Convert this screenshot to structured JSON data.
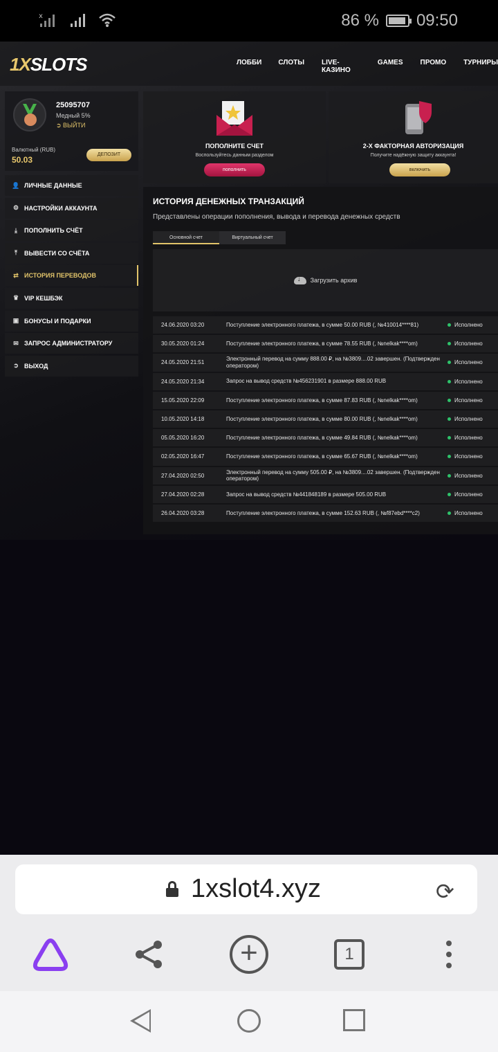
{
  "status_bar": {
    "battery": "86 %",
    "time": "09:50"
  },
  "site": {
    "logo_one": "1X",
    "logo_rest": "SLOTS",
    "nav": [
      "ЛОББИ",
      "СЛОТЫ",
      "LIVE-КАЗИНО",
      "GAMES",
      "ПРОМО",
      "ТУРНИРЫ"
    ],
    "profile": {
      "id": "25095707",
      "level": "Медный 5%",
      "logout": "ВЫЙТИ",
      "currency_label": "Валютный (RUB)",
      "balance": "50.03",
      "deposit_button": "ДЕПОЗИТ"
    },
    "menu": [
      {
        "label": "ЛИЧНЫЕ ДАННЫЕ",
        "icon": "user-plus-icon"
      },
      {
        "label": "НАСТРОЙКИ АККАУНТА",
        "icon": "gears-icon"
      },
      {
        "label": "ПОПОЛНИТЬ СЧЁТ",
        "icon": "download-icon"
      },
      {
        "label": "ВЫВЕСТИ СО СЧЁТА",
        "icon": "upload-icon"
      },
      {
        "label": "ИСТОРИЯ ПЕРЕВОДОВ",
        "icon": "transfer-arrows-icon"
      },
      {
        "label": "VIP КЕШБЭК",
        "icon": "crown-icon"
      },
      {
        "label": "БОНУСЫ И ПОДАРКИ",
        "icon": "gift-icon"
      },
      {
        "label": "ЗАПРОС АДМИНИСТРАТОРУ",
        "icon": "envelope-icon"
      },
      {
        "label": "ВЫХОД",
        "icon": "logout-icon"
      }
    ],
    "cards": {
      "deposit": {
        "title": "ПОПОЛНИТЕ СЧЕТ",
        "text": "Воспользуйтесь данным разделом",
        "button": "пополнить"
      },
      "twofa": {
        "title": "2-Х ФАКТОРНАЯ АВТОРИЗАЦИЯ",
        "text": "Получите надёжную защиту аккаунта!",
        "button": "включить"
      }
    },
    "history": {
      "title": "ИСТОРИЯ ДЕНЕЖНЫХ ТРАНЗАКЦИЙ",
      "subtitle": "Представлены операции пополнения, вывода и перевода денежных средств",
      "tab_main": "Основной счет",
      "tab_virtual": "Виртуальный счет",
      "archive": "Загрузить архив",
      "rows": [
        {
          "date": "24.06.2020 03:20",
          "text": "Поступление электронного платежа, в сумме 50.00 RUB (, №410014****81)",
          "status": "Исполнено"
        },
        {
          "date": "30.05.2020 01:24",
          "text": "Поступление электронного платежа, в сумме 78.55 RUB (, №nelkak****om)",
          "status": "Исполнено"
        },
        {
          "date": "24.05.2020 21:51",
          "text": "Электронный перевод на сумму 888.00 ₽, на №3809....02 завершен. (Подтвержден оператором)",
          "status": "Исполнено"
        },
        {
          "date": "24.05.2020 21:34",
          "text": "Запрос на вывод средств №456231901 в размере 888.00 RUB",
          "status": "Исполнено"
        },
        {
          "date": "15.05.2020 22:09",
          "text": "Поступление электронного платежа, в сумме 87.83 RUB (, №nelkak****om)",
          "status": "Исполнено"
        },
        {
          "date": "10.05.2020 14:18",
          "text": "Поступление электронного платежа, в сумме 80.00 RUB (, №nelkak****om)",
          "status": "Исполнено"
        },
        {
          "date": "05.05.2020 16:20",
          "text": "Поступление электронного платежа, в сумме 49.84 RUB (, №nelkak****om)",
          "status": "Исполнено"
        },
        {
          "date": "02.05.2020 16:47",
          "text": "Поступление электронного платежа, в сумме 65.67 RUB (, №nelkak****om)",
          "status": "Исполнено"
        },
        {
          "date": "27.04.2020 02:50",
          "text": "Электронный перевод на сумму 505.00 ₽, на №3809....02 завершен. (Подтвержден оператором)",
          "status": "Исполнено"
        },
        {
          "date": "27.04.2020 02:28",
          "text": "Запрос на вывод средств №441848189 в размере 505.00 RUB",
          "status": "Исполнено"
        },
        {
          "date": "26.04.2020 03:28",
          "text": "Поступление электронного платежа, в сумме 152.63 RUB (, №f87ebd****c2)",
          "status": "Исполнено"
        }
      ]
    }
  },
  "browser": {
    "url": "1xslot4.xyz",
    "tab_count": "1"
  },
  "colors": {
    "accent_gold": "#e2c46a",
    "accent_pink": "#c8204f",
    "status_green": "#2ec26a"
  }
}
